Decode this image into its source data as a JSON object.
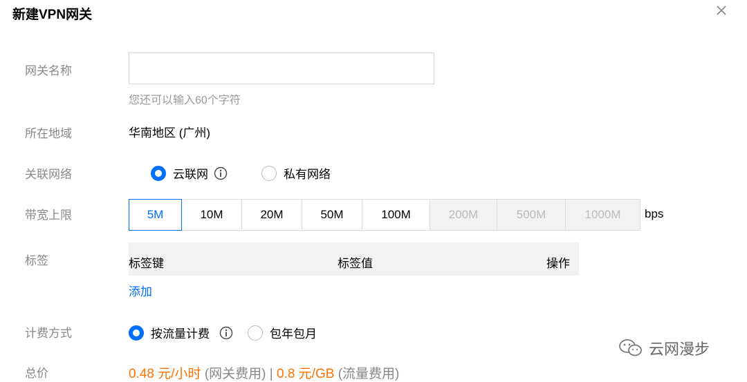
{
  "dialog": {
    "title": "新建VPN网关"
  },
  "form": {
    "name": {
      "label": "网关名称",
      "value": "",
      "hint": "您还可以输入60个字符"
    },
    "region": {
      "label": "所在地域",
      "value": "华南地区 (广州)"
    },
    "network": {
      "label": "关联网络",
      "options": [
        "云联网",
        "私有网络"
      ],
      "selected": "云联网"
    },
    "bandwidth": {
      "label": "带宽上限",
      "options": [
        "5M",
        "10M",
        "20M",
        "50M",
        "100M",
        "200M",
        "500M",
        "1000M"
      ],
      "selected": "5M",
      "disabled": [
        "200M",
        "500M",
        "1000M"
      ],
      "unit": "bps"
    },
    "tags": {
      "label": "标签",
      "columns": [
        "标签键",
        "标签值",
        "操作"
      ],
      "add_label": "添加"
    },
    "billing": {
      "label": "计费方式",
      "options": [
        "按流量计费",
        "包年包月"
      ],
      "selected": "按流量计费"
    },
    "total": {
      "label": "总价",
      "gateway_price": "0.48 元/小时",
      "gateway_note": "(网关费用)",
      "separator": "|",
      "traffic_price": "0.8 元/GB",
      "traffic_note": "(流量费用)"
    }
  },
  "watermark": {
    "text": "云网漫步"
  },
  "colors": {
    "accent": "#006eff",
    "price": "#ff7200",
    "label": "#888888",
    "disabled_bg": "#f2f2f2"
  }
}
